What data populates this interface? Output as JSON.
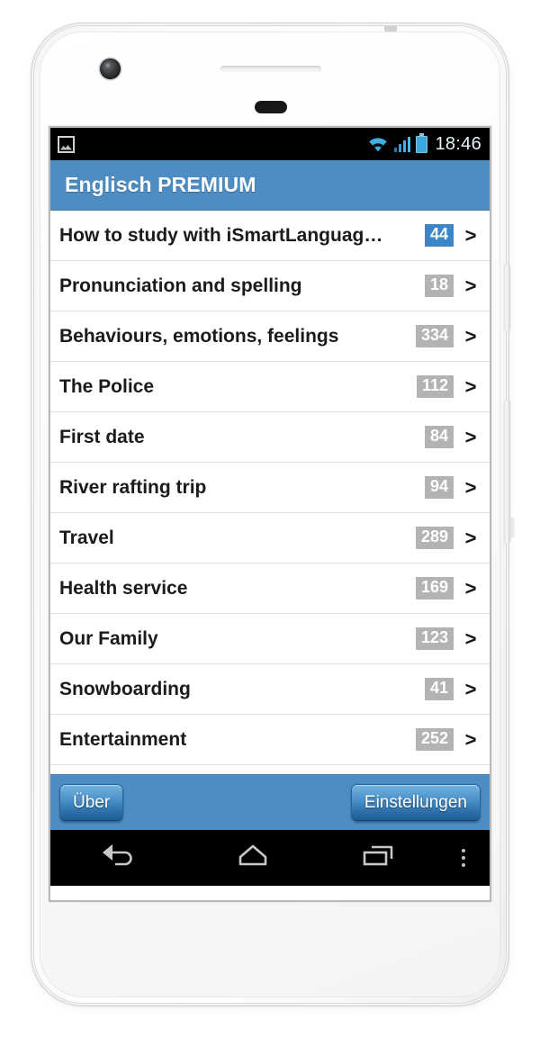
{
  "device": {
    "camera_icon": "front-camera",
    "speaker": "earpiece-speaker",
    "sensor": "proximity-sensor"
  },
  "status_bar": {
    "notification_icon": "gallery-image-icon",
    "wifi_icon": "wifi-icon",
    "signal_icon": "cellular-signal-icon",
    "battery_icon": "battery-icon",
    "time": "18:46"
  },
  "header": {
    "title": "Englisch PREMIUM",
    "background_color": "#4d8dc4"
  },
  "list": {
    "chevron": ">",
    "accent_badge_color": "#3b86c8",
    "default_badge_color": "#b3b3b3",
    "items": [
      {
        "title": "How to study with iSmartLanguag…",
        "count": "44",
        "accent": true
      },
      {
        "title": "Pronunciation and spelling",
        "count": "18",
        "accent": false
      },
      {
        "title": "Behaviours, emotions, feelings",
        "count": "334",
        "accent": false
      },
      {
        "title": "The Police",
        "count": "112",
        "accent": false
      },
      {
        "title": "First date",
        "count": "84",
        "accent": false
      },
      {
        "title": "River rafting trip",
        "count": "94",
        "accent": false
      },
      {
        "title": "Travel",
        "count": "289",
        "accent": false
      },
      {
        "title": "Health service",
        "count": "169",
        "accent": false
      },
      {
        "title": "Our Family",
        "count": "123",
        "accent": false
      },
      {
        "title": "Snowboarding",
        "count": "41",
        "accent": false
      },
      {
        "title": "Entertainment",
        "count": "252",
        "accent": false
      }
    ]
  },
  "action_bar": {
    "about_label": "Über",
    "settings_label": "Einstellungen"
  },
  "nav_bar": {
    "back_icon": "back-arrow-icon",
    "home_icon": "home-icon",
    "recents_icon": "recent-apps-icon",
    "menu_icon": "overflow-menu-icon"
  }
}
